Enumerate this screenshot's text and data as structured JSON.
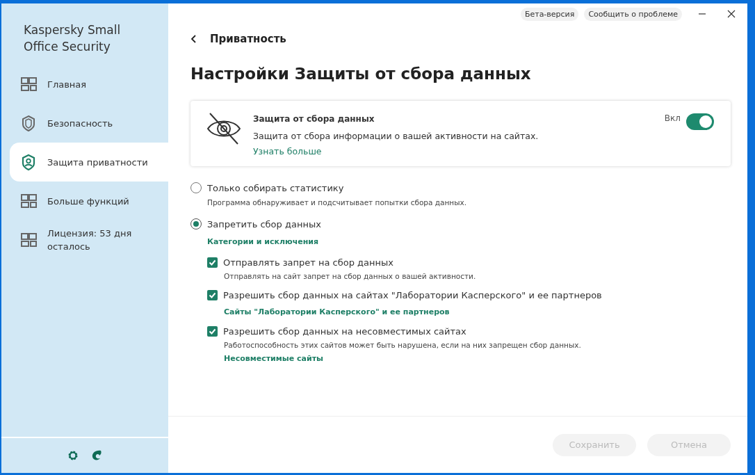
{
  "sidebar": {
    "app_title": "Kaspersky Small Office Security",
    "items": [
      {
        "label": "Главная",
        "kind": "grid",
        "selected": false
      },
      {
        "label": "Безопасность",
        "kind": "shield",
        "selected": false
      },
      {
        "label": "Защита приватности",
        "kind": "privacy",
        "selected": true
      },
      {
        "label": "Больше функций",
        "kind": "grid",
        "selected": false
      },
      {
        "label": "Лицензия: 53 дня осталось",
        "kind": "grid",
        "selected": false
      }
    ]
  },
  "top_bar": {
    "chips": [
      "Бета-версия",
      "Сообщить о проблеме"
    ]
  },
  "breadcrumb": "Приватность",
  "title": "Настройки Защиты от сбора данных",
  "feature_card": {
    "title": "Защита от сбора данных",
    "description": "Защита от сбора информации о вашей активности на сайтах.",
    "link": "Узнать больше",
    "toggle_label": "Вкл",
    "on": true
  },
  "modes": [
    {
      "label": "Только собирать статистику",
      "description": "Программа обнаруживает и подсчитывает попытки сбора данных.",
      "selected": false
    },
    {
      "label": "Запретить сбор данных",
      "link": "Категории и исключения",
      "selected": true,
      "options": [
        {
          "label": "Отправлять запрет на сбор данных",
          "description": "Отправлять на сайт запрет на сбор данных о вашей активности.",
          "checked": true
        },
        {
          "label": "Разрешить сбор данных на сайтах \"Лаборатории Касперского\" и ее партнеров",
          "link": "Сайты \"Лаборатории Касперского\" и ее партнеров",
          "checked": true
        },
        {
          "label": "Разрешить сбор данных на несовместимых сайтах",
          "description": "Работоспособность этих сайтов может быть нарушена, если на них запрещен сбор данных.",
          "link": "Несовместимые сайты",
          "checked": true
        }
      ]
    }
  ],
  "footer": {
    "buttons": [
      {
        "label": "Сохранить",
        "disabled": true
      },
      {
        "label": "Отмена",
        "disabled": true
      }
    ]
  }
}
